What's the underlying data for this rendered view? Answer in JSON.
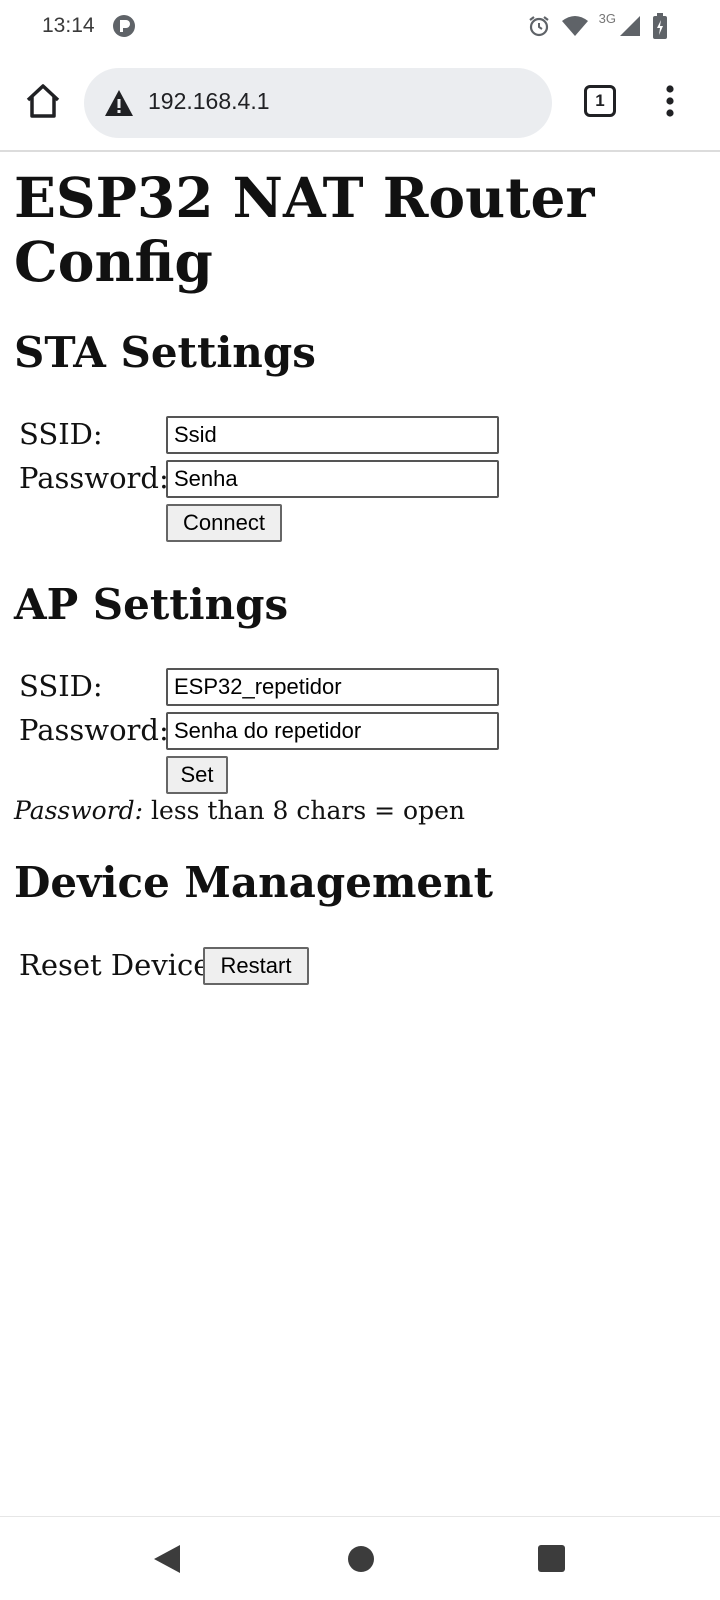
{
  "status_bar": {
    "time": "13:14",
    "network_type": "3G",
    "icons": [
      "app-notification-icon",
      "alarm-icon",
      "wifi-icon",
      "cellular-signal-icon",
      "battery-charging-icon"
    ]
  },
  "browser": {
    "url": "192.168.4.1",
    "tab_count": "1",
    "icons": [
      "home-icon",
      "warning-icon",
      "more-vert-icon"
    ]
  },
  "page": {
    "title": "ESP32 NAT Router Config",
    "sta": {
      "heading": "STA Settings",
      "ssid_label": "SSID:",
      "ssid_value": "Ssid",
      "password_label": "Password:",
      "password_value": "Senha",
      "connect_label": "Connect"
    },
    "ap": {
      "heading": "AP Settings",
      "ssid_label": "SSID:",
      "ssid_value": "ESP32_repetidor",
      "password_label": "Password:",
      "password_value": "Senha do repetidor",
      "set_label": "Set",
      "note_em": "Password:",
      "note_text": " less than 8 chars = open"
    },
    "device": {
      "heading": "Device Management",
      "reset_label": "Reset Device:",
      "restart_label": "Restart"
    }
  },
  "nav_bar": {
    "icons": [
      "back-icon",
      "home-circle-icon",
      "recents-icon"
    ]
  },
  "colors": {
    "urlbar_bg": "#ebedf0",
    "button_bg": "#efefef",
    "nav_icon": "#3c3c3c"
  }
}
